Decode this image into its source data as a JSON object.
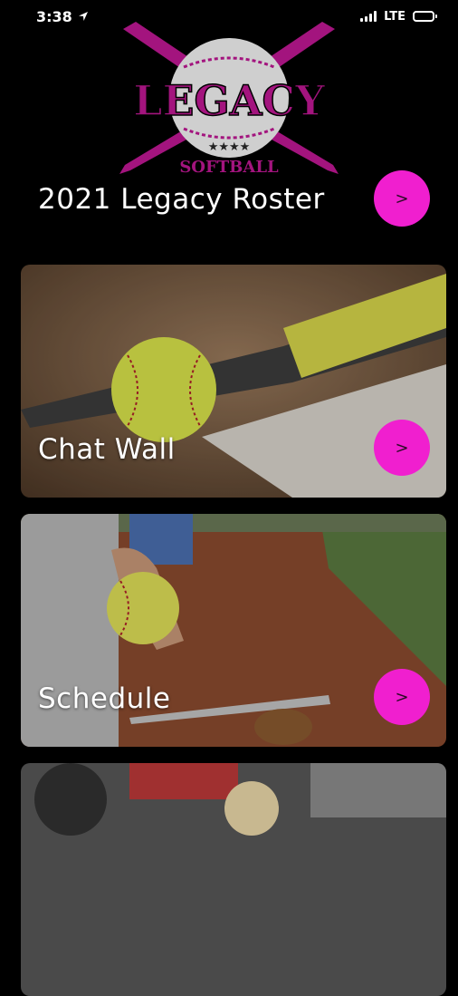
{
  "status_bar": {
    "time": "3:38",
    "network": "LTE"
  },
  "logo": {
    "text_main": "LEGACY",
    "text_sub": "SOFTBALL",
    "stars": "★★★★",
    "color": "#a3147e"
  },
  "roster": {
    "title": "2021 Legacy Roster",
    "button_label": ">"
  },
  "cards": [
    {
      "label": "Chat Wall",
      "button_label": ">"
    },
    {
      "label": "Schedule",
      "button_label": ">"
    }
  ],
  "colors": {
    "accent": "#f01fcf",
    "background": "#000000"
  }
}
